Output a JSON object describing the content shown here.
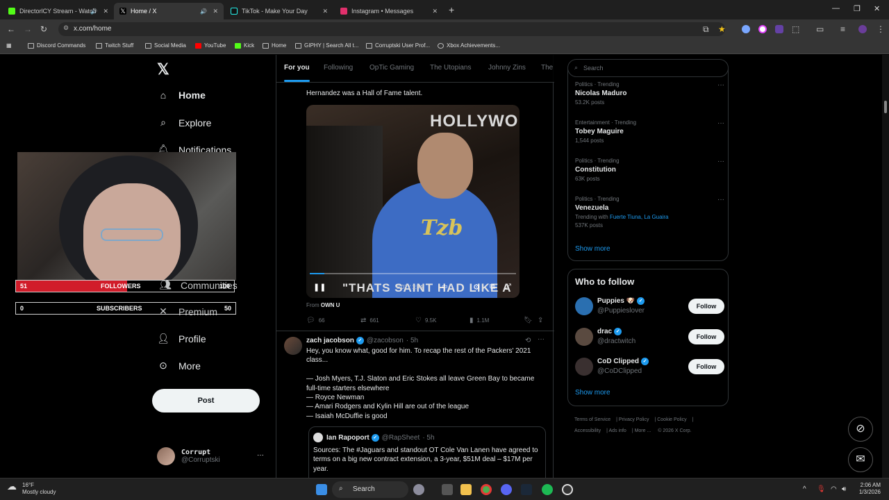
{
  "browser": {
    "tabs": [
      {
        "label": "DirectorlCY Stream - Watch",
        "color": "#53fc18"
      },
      {
        "label": "Home / X",
        "color": "#000000"
      },
      {
        "label": "TikTok - Make Your Day",
        "color": "#111111"
      },
      {
        "label": "Instagram • Messages",
        "color": "#e1306c"
      }
    ],
    "url": "x.com/home",
    "bookmarks": [
      "Discord Commands",
      "Twitch Stuff",
      "Social Media",
      "YouTube",
      "Kick",
      "Home",
      "GIPHY | Search All t...",
      "Corruptski User Prof...",
      "Xbox Achievements..."
    ]
  },
  "sidebar": {
    "items": [
      {
        "label": "Home",
        "icon": "home-icon"
      },
      {
        "label": "Explore",
        "icon": "search-icon"
      },
      {
        "label": "Notifications",
        "icon": "bell-icon"
      },
      {
        "label": "Communities",
        "icon": "people-icon"
      },
      {
        "label": "Premium",
        "icon": "x-icon"
      },
      {
        "label": "Profile",
        "icon": "person-icon"
      },
      {
        "label": "More",
        "icon": "more-circle-icon"
      }
    ],
    "post_label": "Post",
    "account": {
      "name": "Corrupt",
      "handle": "@Corruptski"
    }
  },
  "overlay": {
    "followers_label": "FOLLOWERS",
    "followers_count": "51",
    "followers_goal": "100",
    "followers_progress": 0.51,
    "subscribers_label": "SUBSCRIBERS",
    "subscribers_count": "0",
    "subscribers_goal": "50"
  },
  "feed": {
    "tabs": [
      "For you",
      "Following",
      "OpTic Gaming",
      "The Utopians",
      "Johnny Zins",
      "The"
    ],
    "post1": {
      "text": "Hernandez was a Hall of Fame talent.",
      "video_sign": "HOLLYWO",
      "video_shirt": "Tzb",
      "video_caption": "\"THATS SAINT HAD LIKE A",
      "video_time": "0:07 / 1:34",
      "video_progress": 0.07,
      "from_label": "From",
      "from_source": "OWN U",
      "replies": "66",
      "reposts": "661",
      "likes": "9.5K",
      "views": "1.1M"
    },
    "post2": {
      "name": "zach jacobson",
      "handle": "@zacobson",
      "time": "· 5h",
      "text": "Hey, you know what, good for him. To recap the rest of the Packers' 2021 class...\n\n— Josh Myers, T.J. Slaton and Eric Stokes all leave Green Bay to became full-time starters elsewhere\n— Royce Newman\n— Amari Rodgers and Kylin Hill are out of the league\n— Isaiah McDuffie is good",
      "quote": {
        "name": "Ian Rapoport",
        "handle": "@RapSheet",
        "time": "· 5h",
        "text": "Sources: The #Jaguars and standout OT Cole Van Lanen have agreed to terms on a big new contract extension, a 3-year, $51M deal – $17M per year."
      }
    }
  },
  "right": {
    "search_placeholder": "Search",
    "trends": [
      {
        "category": "Politics · Trending",
        "name": "Nicolas Maduro",
        "count": "53.2K posts"
      },
      {
        "category": "Entertainment · Trending",
        "name": "Tobey Maguire",
        "count": "1,544 posts"
      },
      {
        "category": "Politics · Trending",
        "name": "Constitution",
        "count": "63K posts"
      },
      {
        "category": "Politics · Trending",
        "name": "Venezuela",
        "count": "537K posts",
        "with_label": "Trending with",
        "with_links": "Fuerte Tiuna, La Guaira"
      }
    ],
    "show_more": "Show more",
    "who_to_follow": "Who to follow",
    "follow": [
      {
        "name": "Puppies 🐶",
        "handle": "@Puppieslover",
        "color": "#2a6fb0"
      },
      {
        "name": "drac",
        "handle": "@dractwitch",
        "color": "#5a4a40"
      },
      {
        "name": "CoD Clipped",
        "handle": "@CoDClipped",
        "color": "#3a3030"
      }
    ],
    "follow_label": "Follow",
    "footer": [
      "Terms of Service",
      "Privacy Policy",
      "Cookie Policy",
      "Accessibility",
      "Ads info",
      "More ...",
      "© 2026 X Corp."
    ]
  },
  "taskbar": {
    "temp": "16°F",
    "weather": "Mostly cloudy",
    "search": "Search",
    "time": "2:06 AM",
    "date": "1/3/2026"
  }
}
